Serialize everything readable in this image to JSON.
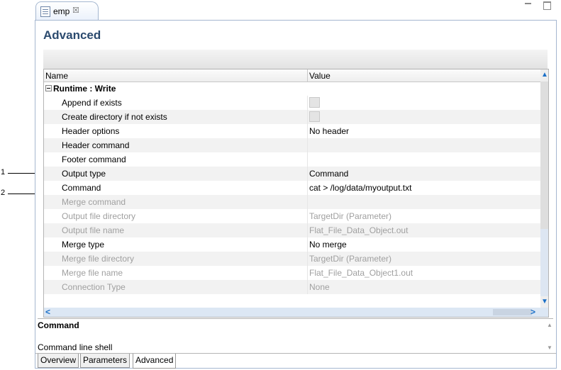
{
  "window": {
    "tab_title": "emp",
    "tab_close": "☒"
  },
  "page_title": "Advanced",
  "callouts": [
    "1",
    "2"
  ],
  "grid": {
    "col_name": "Name",
    "col_value": "Value",
    "group": "Runtime : Write",
    "rows": [
      {
        "name": "Append if exists",
        "value": "",
        "checkbox": true,
        "disabled": false
      },
      {
        "name": "Create directory if not exists",
        "value": "",
        "checkbox": true,
        "disabled": false
      },
      {
        "name": "Header options",
        "value": "No header",
        "checkbox": false,
        "disabled": false
      },
      {
        "name": "Header command",
        "value": "",
        "checkbox": false,
        "disabled": false
      },
      {
        "name": "Footer command",
        "value": "",
        "checkbox": false,
        "disabled": false
      },
      {
        "name": "Output type",
        "value": "Command",
        "checkbox": false,
        "disabled": false
      },
      {
        "name": "Command",
        "value": "cat > /log/data/myoutput.txt",
        "checkbox": false,
        "disabled": false
      },
      {
        "name": "Merge command",
        "value": "",
        "checkbox": false,
        "disabled": true
      },
      {
        "name": "Output file directory",
        "value": "TargetDir (Parameter)",
        "checkbox": false,
        "disabled": true
      },
      {
        "name": "Output file name",
        "value": "Flat_File_Data_Object.out",
        "checkbox": false,
        "disabled": true
      },
      {
        "name": "Merge type",
        "value": "No merge",
        "checkbox": false,
        "disabled": false
      },
      {
        "name": "Merge file directory",
        "value": "TargetDir (Parameter)",
        "checkbox": false,
        "disabled": true
      },
      {
        "name": "Merge file name",
        "value": "Flat_File_Data_Object1.out",
        "checkbox": false,
        "disabled": true
      },
      {
        "name": "Connection Type",
        "value": "None",
        "checkbox": false,
        "disabled": true
      }
    ]
  },
  "description": {
    "title": "Command",
    "text": "Command line shell"
  },
  "page_tabs": [
    "Overview",
    "Parameters",
    "Advanced"
  ],
  "active_page_tab": "Advanced",
  "colors": {
    "title": "#2b4a6e",
    "scroll_arrow": "#1a6fc7",
    "disabled_text": "#a0a0a0"
  }
}
